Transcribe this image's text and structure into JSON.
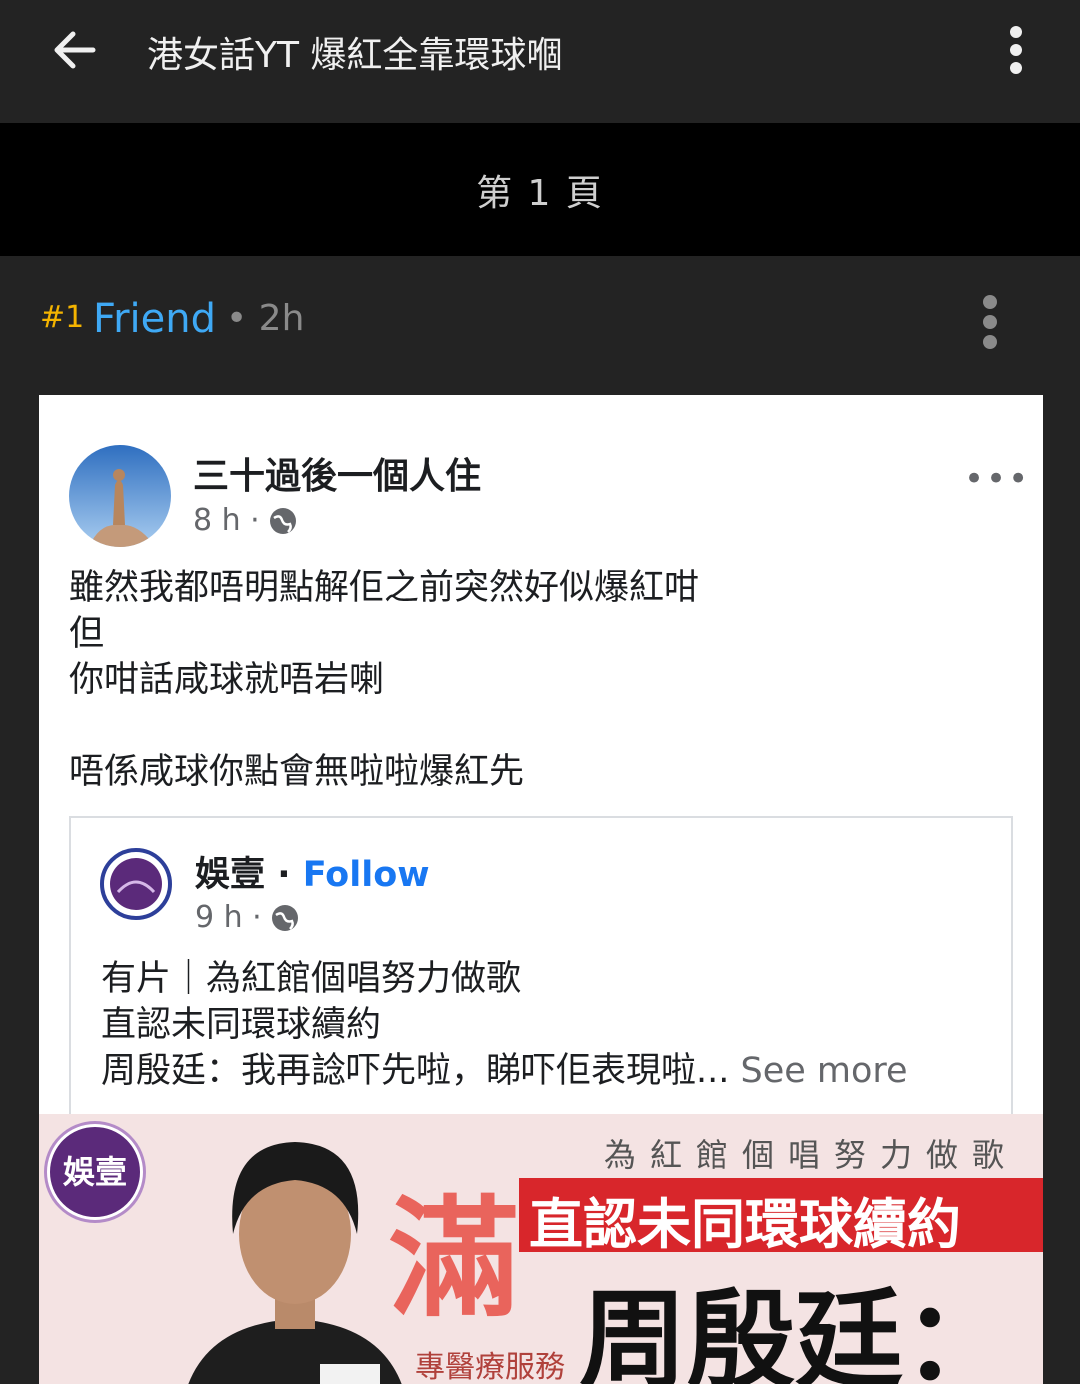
{
  "appbar": {
    "title": "港女話YT 爆紅全靠環球嗰",
    "back_icon": "arrow-left-icon",
    "menu_icon": "kebab-icon"
  },
  "pager": {
    "label": "第 1 頁"
  },
  "post": {
    "number": "#1",
    "username": "Friend",
    "time": "• 2h",
    "colors": {
      "number": "#f4b400",
      "username": "#3fa9f5"
    }
  },
  "screenshot": {
    "author": "三十過後一個人住",
    "meta": "8 h ·",
    "more": "•••",
    "text_lines": [
      "雖然我都唔明點解佢之前突然好似爆紅咁",
      "但",
      "你咁話咸球就唔岩喇",
      "",
      "唔係咸球你點會無啦啦爆紅先"
    ],
    "shared": {
      "author": "娛壹",
      "separator": " · ",
      "follow": "Follow",
      "meta": "9 h ·",
      "text_lines": [
        "有片｜為紅館個唱努力做歌",
        "直認未同環球續約"
      ],
      "last_line": "周殷廷：我再諗吓先啦，睇吓佢表現啦...",
      "see_more": " See more"
    },
    "banner": {
      "logo": "娛壹",
      "subtitle": "為紅館個唱努力做歌",
      "headline": "直認未同環球續約",
      "big": "周殷廷：",
      "watermark": "滿",
      "footer": "專醫療服務"
    }
  }
}
